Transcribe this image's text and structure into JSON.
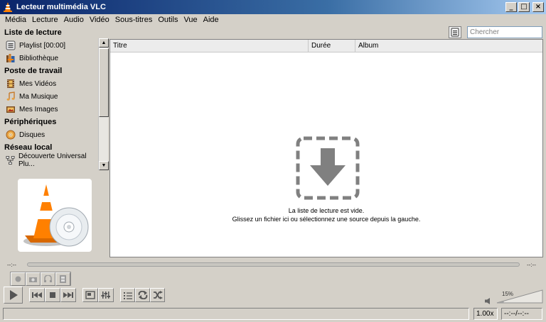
{
  "window": {
    "title": "Lecteur multimédia VLC",
    "minimize_glyph": "_",
    "maximize_glyph": "□",
    "close_glyph": "×"
  },
  "menu": [
    "Média",
    "Lecture",
    "Audio",
    "Vidéo",
    "Sous-titres",
    "Outils",
    "Vue",
    "Aide"
  ],
  "sidebar": {
    "sections": [
      {
        "heading": "Liste de lecture",
        "items": [
          {
            "label": "Playlist [00:00]",
            "icon": "playlist-icon"
          },
          {
            "label": "Bibliothèque",
            "icon": "library-icon"
          }
        ]
      },
      {
        "heading": "Poste de travail",
        "items": [
          {
            "label": "Mes Vidéos",
            "icon": "film-icon"
          },
          {
            "label": "Ma Musique",
            "icon": "music-note-icon"
          },
          {
            "label": "Mes Images",
            "icon": "image-icon"
          }
        ]
      },
      {
        "heading": "Périphériques",
        "items": [
          {
            "label": "Disques",
            "icon": "disc-icon"
          }
        ]
      },
      {
        "heading": "Réseau local",
        "items": [
          {
            "label": "Découverte Universal Plu...",
            "icon": "network-icon"
          }
        ]
      }
    ]
  },
  "search": {
    "placeholder": "Chercher"
  },
  "playlist": {
    "columns": [
      "Titre",
      "Durée",
      "Album"
    ],
    "empty_line1": "La liste de lecture est vide.",
    "empty_line2": "Glissez un fichier ici ou sélectionnez une source depuis la gauche."
  },
  "seek": {
    "elapsed": "--:--",
    "remaining": "--:--",
    "position": 0
  },
  "volume": {
    "label": "15%",
    "level": 0.15
  },
  "status": {
    "speed": "1.00x",
    "time": "--:--/--:--"
  },
  "colors": {
    "accent": "#ff8000",
    "titlebar": "#0a246a",
    "drop_icon": "#808080"
  }
}
